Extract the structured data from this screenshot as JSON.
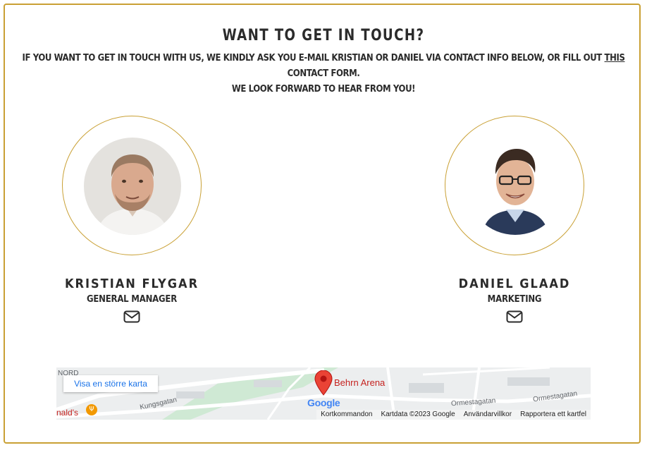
{
  "heading": "WANT TO GET IN TOUCH?",
  "intro": {
    "line1_pre": "IF YOU WANT TO GET IN TOUCH WITH US, WE KINDLY ASK YOU E-MAIL KRISTIAN OR DANIEL VIA CONTACT INFO BELOW, OR FILL OUT ",
    "line1_link": "THIS",
    "line1_post": " CONTACT FORM.",
    "line2": "WE LOOK FORWARD TO HEAR FROM YOU!"
  },
  "people": [
    {
      "name": "KRISTIAN FLYGAR",
      "role": "GENERAL MANAGER",
      "icon": "envelope-icon"
    },
    {
      "name": "DANIEL GLAAD",
      "role": "MARKETING",
      "icon": "envelope-icon"
    }
  ],
  "map": {
    "larger_map_link": "Visa en större karta",
    "place_label": "Behrn Arena",
    "logo": "Google",
    "streets": [
      "Kungsgatan",
      "Ormestagatan",
      "Ormestagatan"
    ],
    "poi_fragment": "nald's",
    "corner_fragment": "NORD",
    "footer": [
      "Kortkommandon",
      "Kartdata ©2023 Google",
      "Användarvillkor",
      "Rapportera ett kartfel"
    ]
  },
  "colors": {
    "accent": "#c9a034",
    "text": "#2b2b2b",
    "map_pin": "#d93025",
    "map_link": "#1a73e8"
  }
}
